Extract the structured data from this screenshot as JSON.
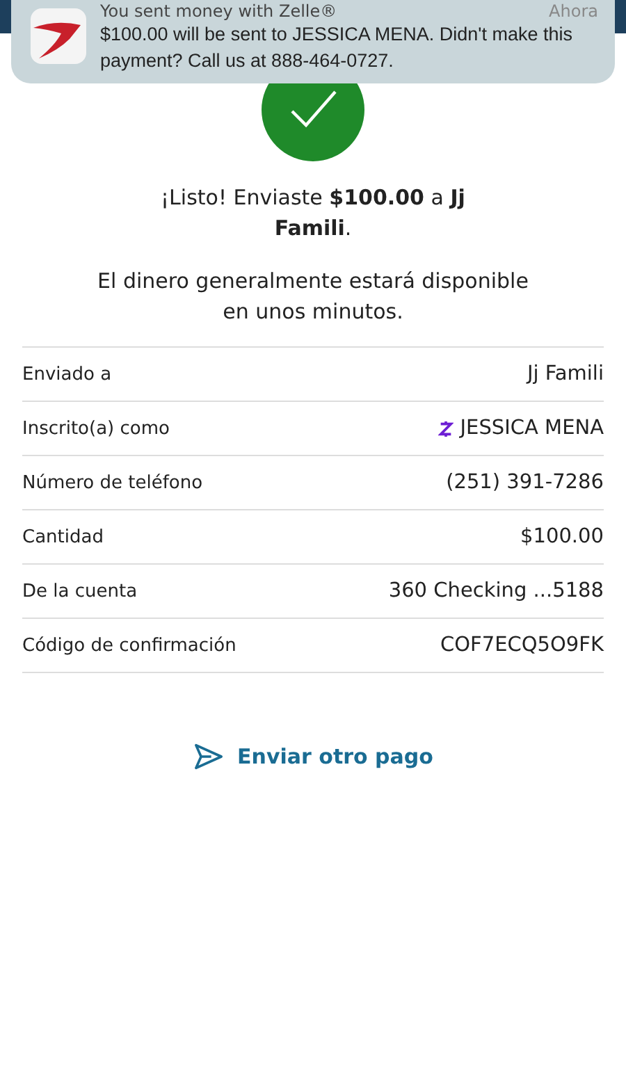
{
  "notification": {
    "title": "You sent money with Zelle®",
    "time": "Ahora",
    "message": "$100.00 will be sent to JESSICA MENA. Didn't make this payment? Call us at 888-464-0727."
  },
  "confirmation": {
    "headline": "¡Listo! Enviaste **$100.00** a **Jj Famili**.",
    "note": "El dinero generalmente estará disponible en unos minutos."
  },
  "details": [
    {
      "label": "Enviado a",
      "value": "Jj Famili",
      "kind": "plain"
    },
    {
      "label": "Inscrito(a) como",
      "value": "JESSICA MENA",
      "kind": "zelle"
    },
    {
      "label": "Número de teléfono",
      "value": "(251) 391-7286",
      "kind": "plain"
    },
    {
      "label": "Cantidad",
      "value": "$100.00",
      "kind": "plain"
    },
    {
      "label": "De la cuenta",
      "value": "360 Checking ...5188",
      "kind": "plain"
    },
    {
      "label": "Código de confirmación",
      "value": "COF7ECQ5O9FK",
      "kind": "plain"
    }
  ],
  "action": {
    "label": "Enviar otro pago"
  }
}
